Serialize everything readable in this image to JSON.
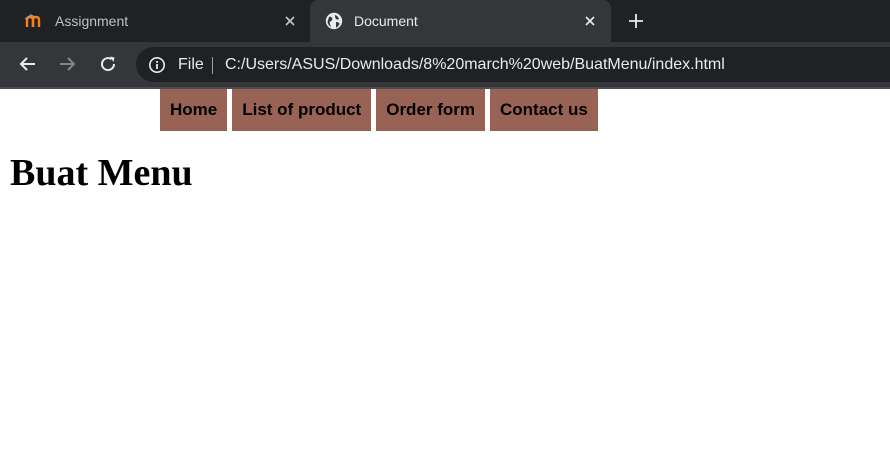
{
  "browser": {
    "tabs": [
      {
        "title": "Assignment",
        "active": false,
        "favicon": "moodle-icon"
      },
      {
        "title": "Document",
        "active": true,
        "favicon": "globe-icon"
      }
    ],
    "omnibox": {
      "scheme_label": "File",
      "url": "C:/Users/ASUS/Downloads/8%20march%20web/BuatMenu/index.html"
    },
    "colors": {
      "tabstrip": "#202124",
      "toolbar": "#35363a",
      "omnibox": "#202124",
      "text": "#e8eaed"
    }
  },
  "page": {
    "menu": {
      "items": [
        {
          "label": "Home"
        },
        {
          "label": "List of product"
        },
        {
          "label": "Order form"
        },
        {
          "label": "Contact us"
        }
      ],
      "item_color": "#986355"
    },
    "heading": "Buat Menu"
  }
}
